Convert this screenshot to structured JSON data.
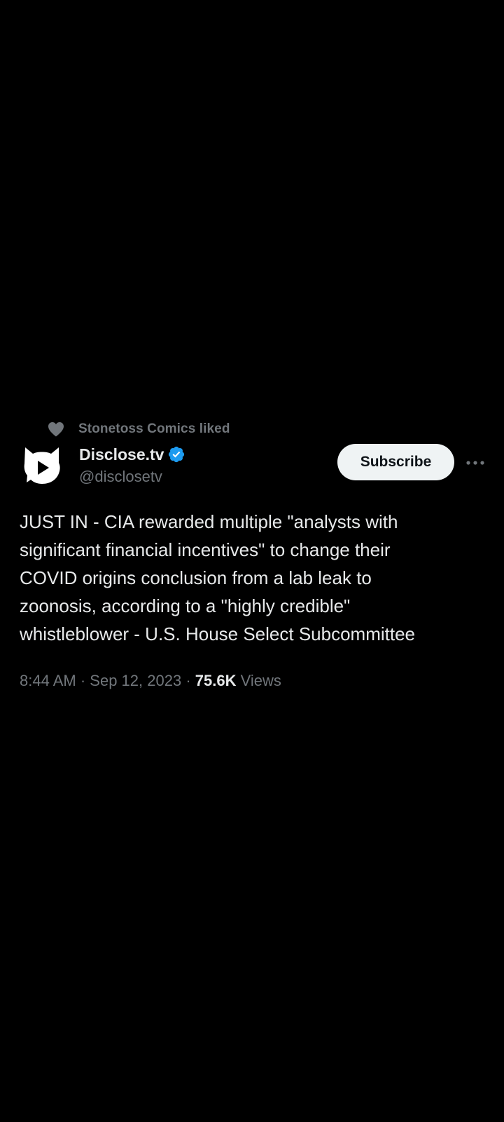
{
  "social_context": {
    "icon": "heart-icon",
    "text": "Stonetoss Comics liked"
  },
  "author": {
    "avatar_icon": "disclose-tv-logo",
    "display_name": "Disclose.tv",
    "verified_icon": "verified-badge-icon",
    "handle": "@disclosetv"
  },
  "actions": {
    "subscribe_label": "Subscribe",
    "more_icon": "more-options-icon"
  },
  "tweet": {
    "text": "JUST IN - CIA rewarded multiple \"analysts with\nsignificant financial incentives\" to change their\nCOVID origins conclusion from a lab leak to\nzoonosis, according to a \"highly credible\"\nwhistleblower - U.S. House Select Subcommittee",
    "time": "8:44 AM",
    "date": "Sep 12, 2023",
    "views_count": "75.6K",
    "views_label": "Views"
  },
  "colors": {
    "background": "#000000",
    "primary_text": "#e7e9ea",
    "secondary_text": "#71767b",
    "verified_blue": "#1d9bf0",
    "button_bg": "#eff3f4"
  }
}
